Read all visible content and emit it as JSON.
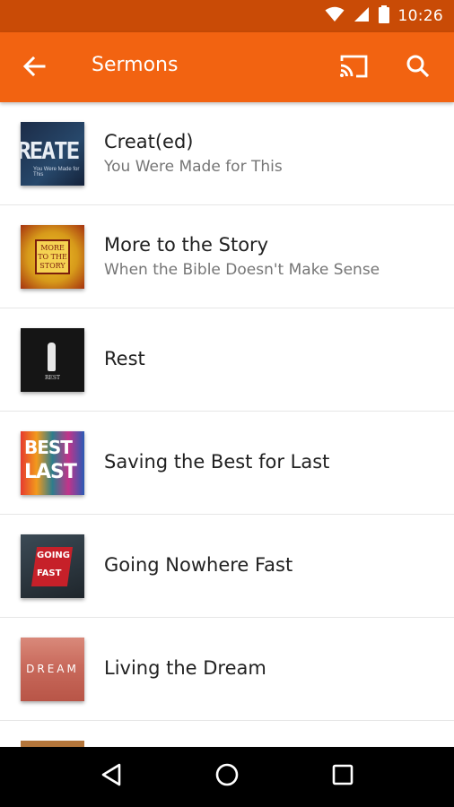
{
  "status_bar": {
    "time": "10:26",
    "icons": [
      "wifi-icon",
      "cellular-signal-icon",
      "battery-icon"
    ]
  },
  "app_bar": {
    "title": "Sermons",
    "back_icon": "arrow-back-icon",
    "actions": [
      "cast-icon",
      "search-icon"
    ],
    "background_color": "#f26311",
    "status_color": "#c94b06"
  },
  "sermons": [
    {
      "title": "Creat(ed)",
      "subtitle": "You Were Made for This",
      "art_text": "REATE",
      "art_subtext": "You Were Made for This"
    },
    {
      "title": "More to the Story",
      "subtitle": "When the Bible Doesn't Make Sense",
      "art_text_lines": [
        "MORE",
        "TO THE",
        "STORY"
      ]
    },
    {
      "title": "Rest",
      "subtitle": "",
      "art_text": "REST"
    },
    {
      "title": "Saving the Best for Last",
      "subtitle": "",
      "art_text_lines": [
        "BEST",
        "LAST"
      ]
    },
    {
      "title": "Going Nowhere Fast",
      "subtitle": "",
      "art_text_lines": [
        "GOING",
        "FAST"
      ]
    },
    {
      "title": "Living the Dream",
      "subtitle": "",
      "art_text": "DREAM"
    }
  ],
  "nav_bar": {
    "buttons": [
      "back-triangle-icon",
      "home-circle-icon",
      "recents-square-icon"
    ]
  }
}
